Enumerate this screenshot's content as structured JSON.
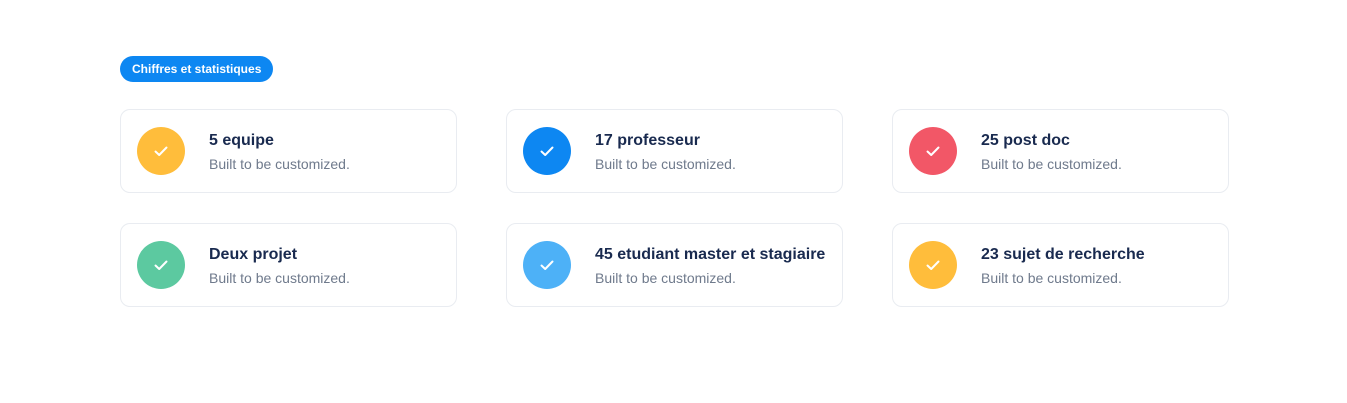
{
  "section": {
    "badge_label": "Chiffres et statistiques"
  },
  "cards": [
    {
      "title": "5 equipe",
      "subtitle": "Built to be customized.",
      "icon": "check-icon",
      "color": "#ffbd3b"
    },
    {
      "title": "17 professeur",
      "subtitle": "Built to be customized.",
      "icon": "check-icon",
      "color": "#0d87f2"
    },
    {
      "title": "25 post doc",
      "subtitle": "Built to be customized.",
      "icon": "check-icon",
      "color": "#f25767"
    },
    {
      "title": "Deux projet",
      "subtitle": "Built to be customized.",
      "icon": "check-icon",
      "color": "#5cc9a0"
    },
    {
      "title": "45 etudiant master et stagiaire",
      "subtitle": "Built to be customized.",
      "icon": "check-icon",
      "color": "#4db1f7"
    },
    {
      "title": "23 sujet de recherche",
      "subtitle": "Built to be customized.",
      "icon": "check-icon",
      "color": "#ffbd3b"
    }
  ]
}
